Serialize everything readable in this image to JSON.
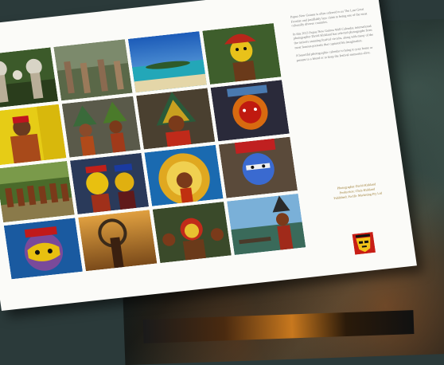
{
  "brochure": {
    "intro_paragraphs": [
      "Papua New Guinea is often referred to as The Last Great Frontier and justifiably lays claim to being one of the most culturally diverse countries.",
      "In this 2023 Papua New Guinea Wall Calendar, international photographer David Kirkland has selected photographs from the nation's stunning festival circuits, along with many of the most famous portraits that captured his imagination.",
      "A beautiful photographic calendar to bring to your home or present to a friend or to keep the festival memories alive."
    ],
    "credits": {
      "photographer": "Photographer David Kirkland",
      "producer": "Production: Chris Kirkland",
      "publisher": "Published: Pacific Marketing Pty Ltd"
    }
  },
  "photos": [
    {
      "name": "mudmen-photo"
    },
    {
      "name": "dancers-forest-photo"
    },
    {
      "name": "island-beach-photo"
    },
    {
      "name": "huli-wigman-photo"
    },
    {
      "name": "yellow-face-woman-photo"
    },
    {
      "name": "feather-dancers-photo"
    },
    {
      "name": "headdress-dancer-photo"
    },
    {
      "name": "red-painted-face-photo"
    },
    {
      "name": "village-dancers-photo"
    },
    {
      "name": "yellow-masks-photo"
    },
    {
      "name": "feather-crown-photo"
    },
    {
      "name": "blue-face-portrait-photo"
    },
    {
      "name": "painted-face-closeup-photo"
    },
    {
      "name": "hoop-warrior-photo"
    },
    {
      "name": "warrior-group-photo"
    },
    {
      "name": "canoe-warrior-photo"
    }
  ],
  "colors": {
    "page": "#fbfbf8",
    "credits_gold": "#9a7a30",
    "background": "#2b3a3a"
  }
}
